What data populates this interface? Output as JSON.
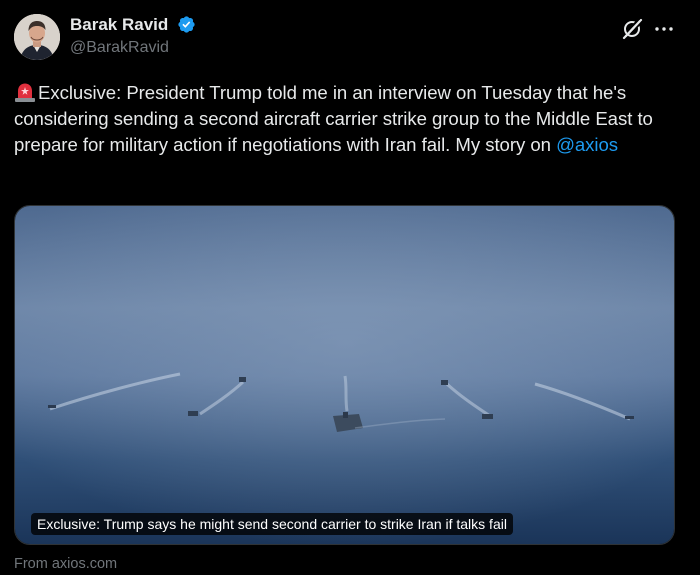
{
  "author": {
    "display_name": "Barak Ravid",
    "handle": "@BarakRavid",
    "verified": true,
    "verified_color": "#1d9bf0"
  },
  "header_actions": {
    "grok_icon": "grok-icon",
    "more_icon": "more-icon"
  },
  "tweet": {
    "emoji": "rotating-light-emoji",
    "text_before_mention": "Exclusive: President Trump told me in an interview on Tuesday that he's considering sending a second aircraft carrier strike group to the Middle East to prepare for military action if negotiations with Iran fail. My story on ",
    "mention": "@axios"
  },
  "link_card": {
    "caption": "Exclusive: Trump says he might send second carrier to strike Iran if talks fail",
    "source": "From axios.com"
  },
  "colors": {
    "background": "#000000",
    "text": "#e7e9ea",
    "muted": "#71767b",
    "link": "#1d9bf0",
    "border": "#2f3336"
  }
}
